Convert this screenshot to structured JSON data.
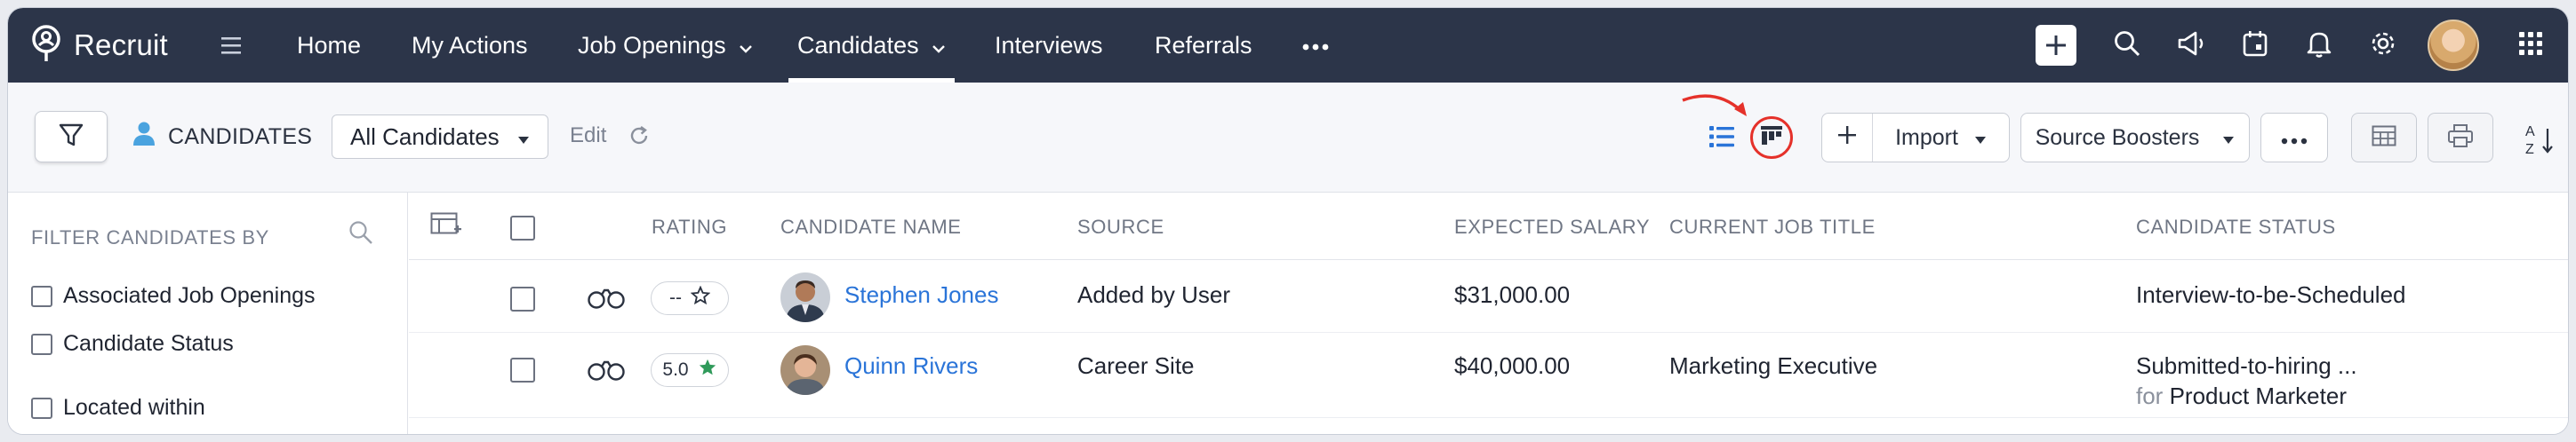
{
  "app": {
    "brand": "Recruit"
  },
  "nav": {
    "items": [
      {
        "label": "Home"
      },
      {
        "label": "My Actions"
      },
      {
        "label": "Job Openings"
      },
      {
        "label": "Candidates"
      },
      {
        "label": "Interviews"
      },
      {
        "label": "Referrals"
      }
    ],
    "active": "Candidates",
    "right_icons": [
      "plus-icon",
      "search-icon",
      "announcement-icon",
      "calendar-icon",
      "bell-icon",
      "gear-icon",
      "avatar",
      "apps-grid-icon"
    ]
  },
  "toolbar": {
    "module_label": "CANDIDATES",
    "view_selected": "All Candidates",
    "edit_label": "Edit",
    "import_label": "Import",
    "source_boosters_label": "Source Boosters"
  },
  "filter_panel": {
    "title": "FILTER CANDIDATES BY",
    "items": [
      {
        "label": "Associated Job Openings"
      },
      {
        "label": "Candidate Status"
      },
      {
        "label": "Located within"
      }
    ]
  },
  "table": {
    "headers": {
      "rating": "RATING",
      "candidate_name": "CANDIDATE NAME",
      "source": "SOURCE",
      "expected_salary": "EXPECTED SALARY",
      "current_job_title": "CURRENT JOB TITLE",
      "candidate_status": "CANDIDATE STATUS"
    },
    "rows": [
      {
        "rating": "--",
        "name": "Stephen Jones",
        "source": "Added by User",
        "expected_salary": "$31,000.00",
        "current_job_title": "",
        "status": "Interview-to-be-Scheduled",
        "status_for_prefix": "",
        "status_for": ""
      },
      {
        "rating": "5.0",
        "name": "Quinn Rivers",
        "source": "Career Site",
        "expected_salary": "$40,000.00",
        "current_job_title": "Marketing Executive",
        "status": "Submitted-to-hiring ...",
        "status_for_prefix": "for",
        "status_for": "Product Marketer"
      }
    ]
  },
  "colors": {
    "nav_bg": "#2c3549",
    "link": "#2a74d8",
    "highlight": "#e5312a",
    "star_filled": "#2f9a5a"
  }
}
